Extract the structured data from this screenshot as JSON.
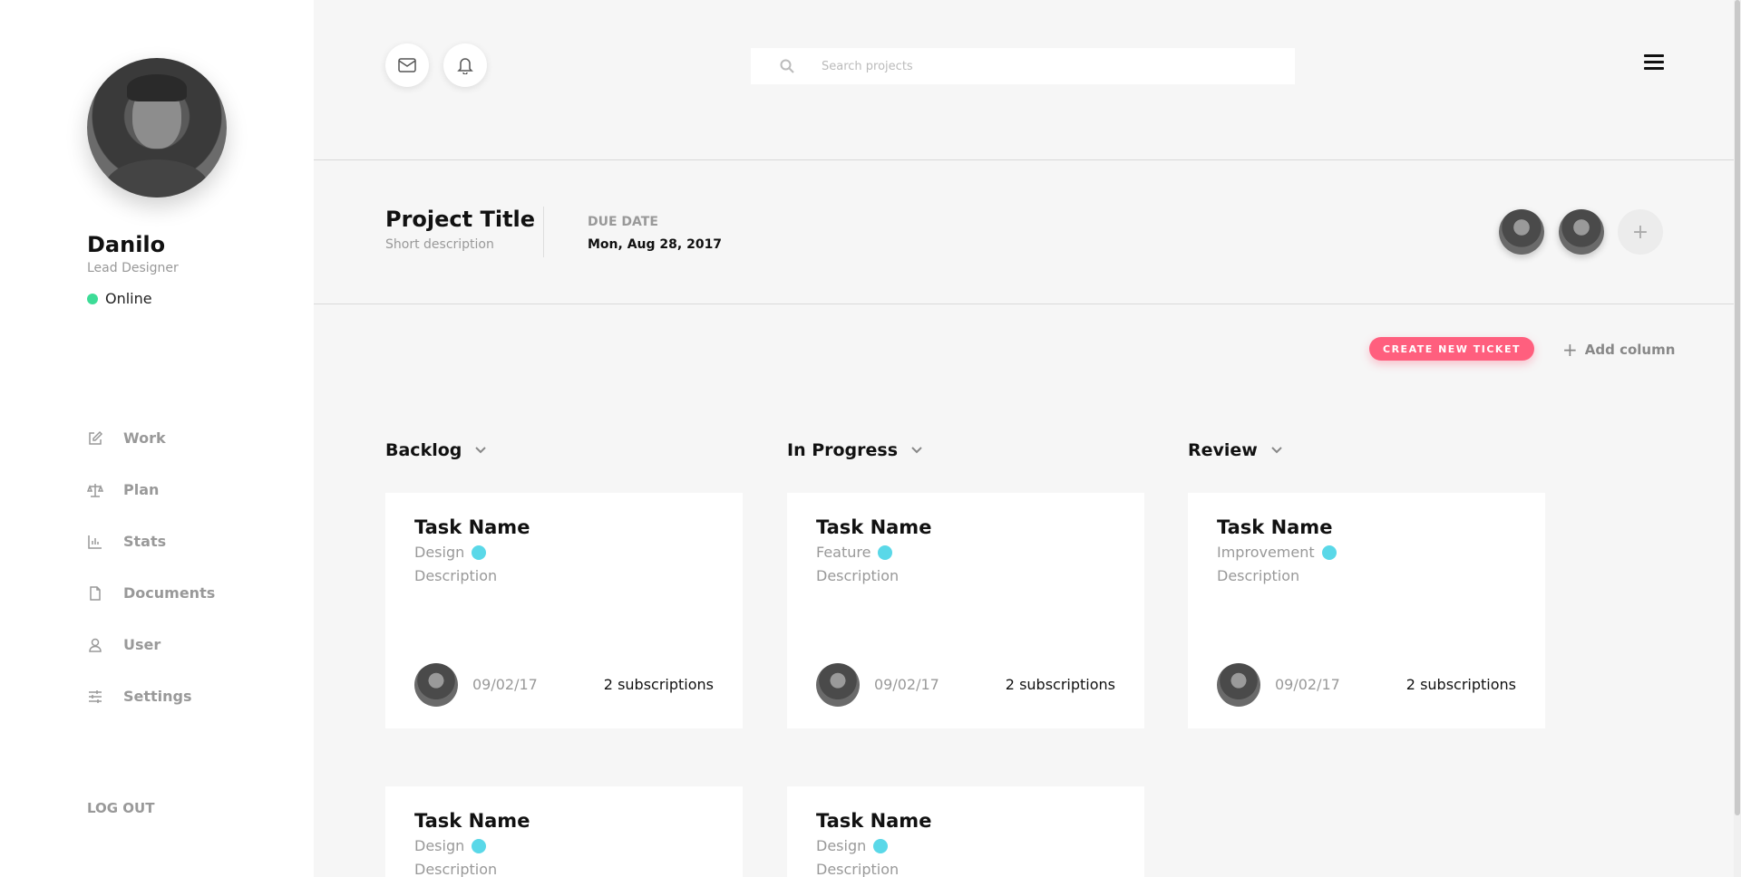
{
  "user": {
    "name": "Danilo",
    "role": "Lead Designer",
    "status": "Online",
    "status_color": "#3ddc97"
  },
  "nav": {
    "items": [
      {
        "label": "Work",
        "icon": "edit-icon"
      },
      {
        "label": "Plan",
        "icon": "balance-scale-icon"
      },
      {
        "label": "Stats",
        "icon": "bar-chart-icon"
      },
      {
        "label": "Documents",
        "icon": "document-icon"
      },
      {
        "label": "User",
        "icon": "user-icon"
      },
      {
        "label": "Settings",
        "icon": "sliders-icon"
      }
    ],
    "logout_label": "LOG OUT"
  },
  "topbar": {
    "search_placeholder": "Search projects",
    "icons": [
      "mail-icon",
      "bell-icon",
      "search-icon",
      "hamburger-menu-icon"
    ]
  },
  "project": {
    "title": "Project Title",
    "description": "Short description",
    "due_label": "DUE DATE",
    "due_value": "Mon, Aug 28, 2017",
    "add_member_label": "+"
  },
  "actions": {
    "create_ticket_label": "CREATE NEW TICKET",
    "add_column_label": "Add column",
    "accent_color": "#ff5f7e"
  },
  "columns": [
    {
      "title": "Backlog",
      "cards": [
        {
          "title": "Task Name",
          "tag": "Design",
          "description": "Description",
          "date": "09/02/17",
          "subscriptions": "2 subscriptions"
        },
        {
          "title": "Task Name",
          "tag": "Design",
          "description": "Description"
        }
      ]
    },
    {
      "title": "In Progress",
      "cards": [
        {
          "title": "Task Name",
          "tag": "Feature",
          "description": "Description",
          "date": "09/02/17",
          "subscriptions": "2 subscriptions"
        },
        {
          "title": "Task Name",
          "tag": "Design",
          "description": "Description"
        }
      ]
    },
    {
      "title": "Review",
      "cards": [
        {
          "title": "Task Name",
          "tag": "Improvement",
          "description": "Description",
          "date": "09/02/17",
          "subscriptions": "2 subscriptions"
        }
      ]
    }
  ],
  "tag_color": "#5ad8e8"
}
